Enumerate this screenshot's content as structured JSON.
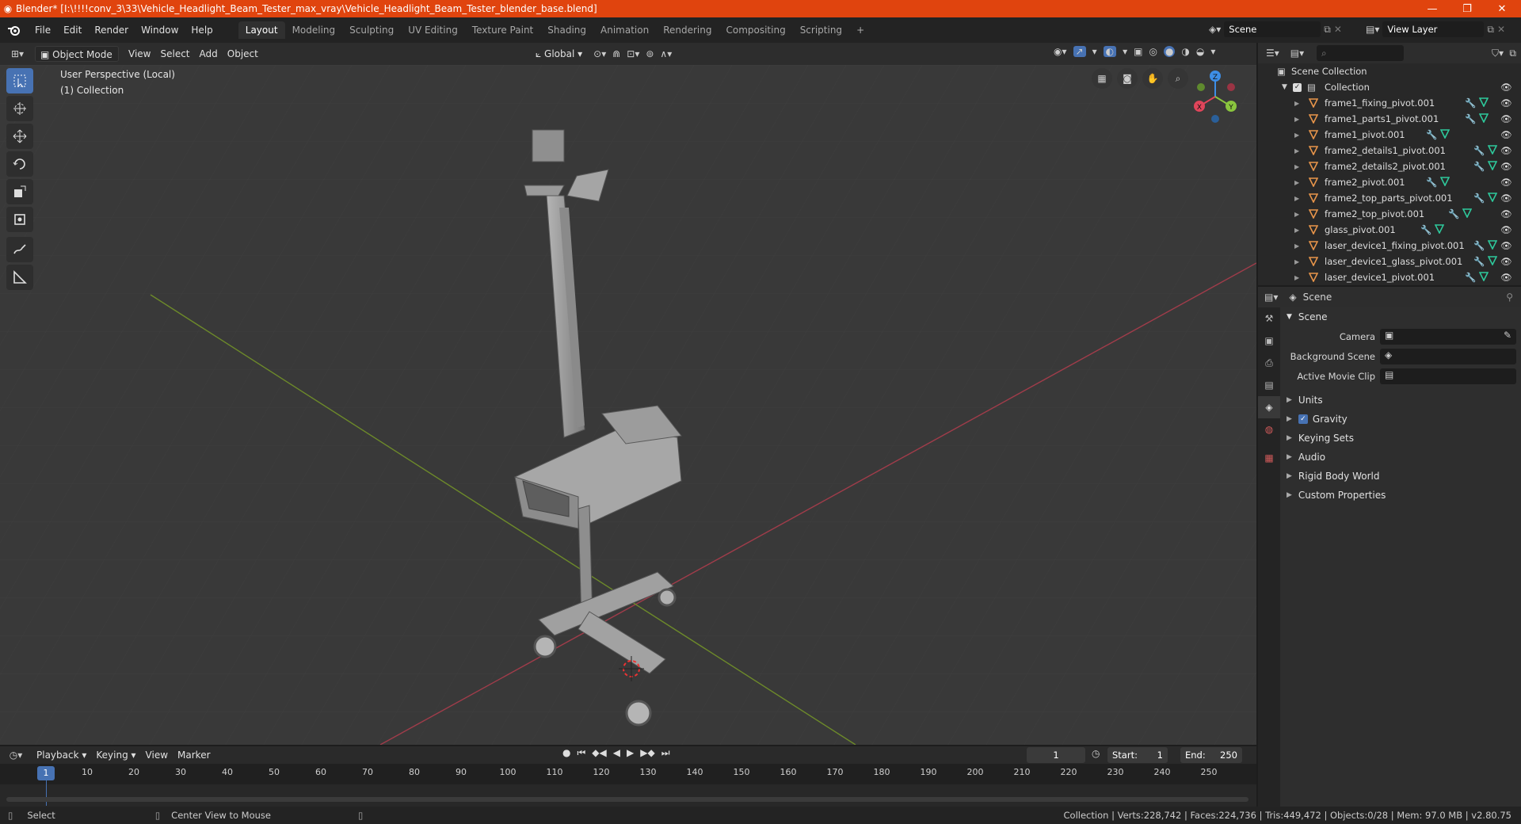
{
  "titlebar": {
    "title": "Blender* [I:\\!!!!conv_3\\33\\Vehicle_Headlight_Beam_Tester_max_vray\\Vehicle_Headlight_Beam_Tester_blender_base.blend]",
    "minimize": "—",
    "maximize": "❐",
    "close": "✕"
  },
  "menu": [
    "File",
    "Edit",
    "Render",
    "Window",
    "Help"
  ],
  "workspaces": [
    "Layout",
    "Modeling",
    "Sculpting",
    "UV Editing",
    "Texture Paint",
    "Shading",
    "Animation",
    "Rendering",
    "Compositing",
    "Scripting"
  ],
  "workspace_add": "+",
  "scene_field": "Scene",
  "view_layer_field": "View Layer",
  "viewport_header": {
    "mode": "Object Mode",
    "view": "View",
    "select": "Select",
    "add": "Add",
    "object": "Object",
    "transform": "Global"
  },
  "viewport": {
    "perspective": "User Perspective (Local)",
    "collection": "(1) Collection",
    "gizmo": {
      "z": "Z",
      "x": "X",
      "y": "Y"
    }
  },
  "outliner": {
    "root": "Scene Collection",
    "collection": "Collection",
    "items": [
      "frame1_fixing_pivot.001",
      "frame1_parts1_pivot.001",
      "frame1_pivot.001",
      "frame2_details1_pivot.001",
      "frame2_details2_pivot.001",
      "frame2_pivot.001",
      "frame2_top_parts_pivot.001",
      "frame2_top_pivot.001",
      "glass_pivot.001",
      "laser_device1_fixing_pivot.001",
      "laser_device1_glass_pivot.001",
      "laser_device1_pivot.001"
    ]
  },
  "properties": {
    "header": "Scene",
    "section": "Scene",
    "camera_label": "Camera",
    "background_scene_label": "Background Scene",
    "active_movie_clip_label": "Active Movie Clip",
    "panels": [
      "Units",
      "Gravity",
      "Keying Sets",
      "Audio",
      "Rigid Body World",
      "Custom Properties"
    ],
    "gravity_checked": true
  },
  "timeline": {
    "playback": "Playback",
    "keying": "Keying",
    "view": "View",
    "marker": "Marker",
    "current_frame": "1",
    "start_label": "Start:",
    "start": "1",
    "end_label": "End:",
    "end": "250",
    "ruler_current": "1",
    "ruler_ticks": [
      "10",
      "20",
      "30",
      "40",
      "50",
      "60",
      "70",
      "80",
      "90",
      "100",
      "110",
      "120",
      "130",
      "140",
      "150",
      "160",
      "170",
      "180",
      "190",
      "200",
      "210",
      "220",
      "230",
      "240",
      "250"
    ]
  },
  "statusbar": {
    "select": "Select",
    "center_view": "Center View to Mouse",
    "stats": "Collection | Verts:228,742 | Faces:224,736 | Tris:449,472 | Objects:0/28 | Mem: 97.0 MB | v2.80.75"
  },
  "colors": {
    "titlebar": "#e0440e",
    "accent": "#4772b3",
    "object_icon": "#e8954a",
    "mesh_icon": "#2ec99c",
    "modifier_icon": "#7aa6f0",
    "axis_x": "#e0455a",
    "axis_y": "#8ac53e",
    "axis_z": "#3d8ee6"
  }
}
